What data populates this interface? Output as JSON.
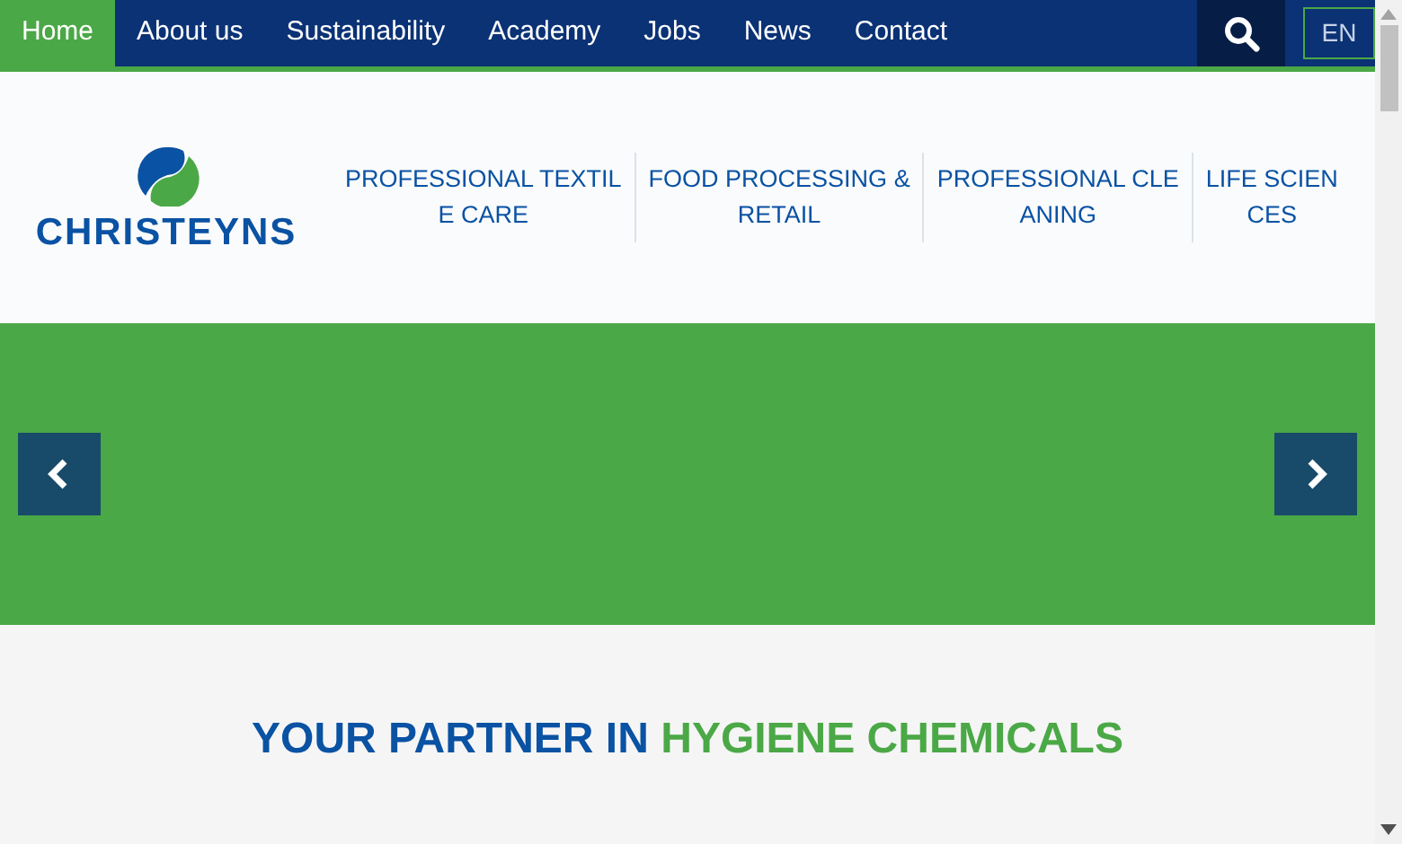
{
  "top_nav": [
    {
      "label": "Home",
      "selected": true
    },
    {
      "label": "About us",
      "selected": false
    },
    {
      "label": "Sustainability",
      "selected": false
    },
    {
      "label": "Academy",
      "selected": false
    },
    {
      "label": "Jobs",
      "selected": false
    },
    {
      "label": "News",
      "selected": false
    },
    {
      "label": "Contact",
      "selected": false
    }
  ],
  "language": "EN",
  "logo": {
    "text": "CHRISTEYNS"
  },
  "categories": [
    {
      "lines": [
        "PROFESSIONAL TEXTIL",
        "E CARE"
      ]
    },
    {
      "lines": [
        "FOOD PROCESSING &",
        "RETAIL"
      ]
    },
    {
      "lines": [
        "PROFESSIONAL CLE",
        "ANING"
      ]
    },
    {
      "lines": [
        "LIFE SCIEN",
        "CES"
      ]
    }
  ],
  "headline": {
    "part_1": "YOUR PARTNER IN",
    "part_2": "HYGIENE CHEMICALS"
  }
}
